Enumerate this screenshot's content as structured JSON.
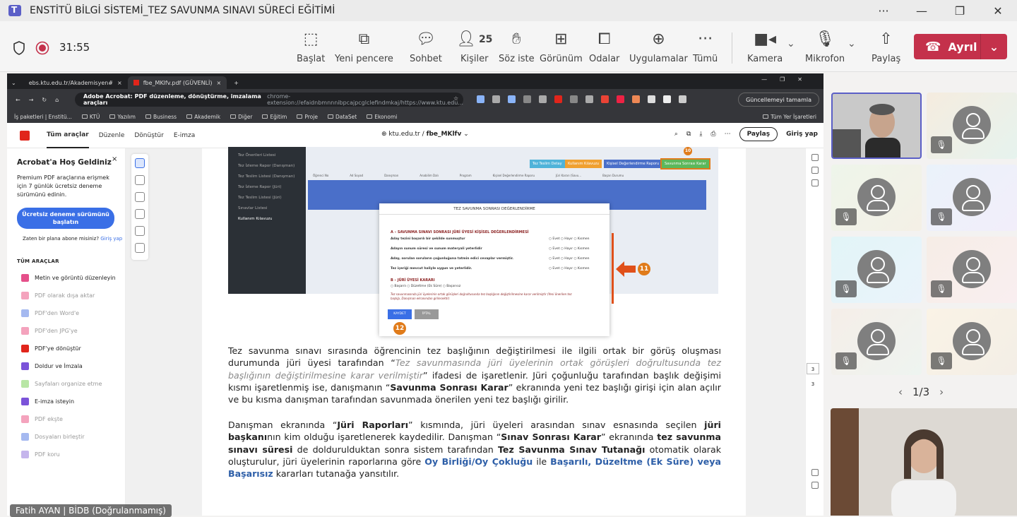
{
  "window": {
    "title": "ENSTİTÜ BİLGİ SİSTEMİ_TEZ SAVUNMA SINAVI SÜRECİ EĞİTİMİ",
    "more": "···",
    "minimize": "—",
    "restore": "❐",
    "close": "✕"
  },
  "meeting": {
    "timer": "31:55",
    "participants_count": "25",
    "buttons": {
      "start": "Başlat",
      "new_window": "Yeni pencere",
      "chat": "Sohbet",
      "people": "Kişiler",
      "raise": "Söz iste",
      "view": "Görünüm",
      "rooms": "Odalar",
      "apps": "Uygulamalar",
      "more": "Tümü",
      "camera": "Kamera",
      "mic": "Mikrofon",
      "share": "Paylaş",
      "leave": "Ayrıl"
    }
  },
  "browser": {
    "tabs": [
      "ebs.ktu.edu.tr/Akademisyen#",
      "fbe_MKlfv.pdf (GÜVENLİ)"
    ],
    "new_tab": "+",
    "address_prefix": "Adobe Acrobat: PDF düzenleme, dönüştürme, imzalama araçları",
    "address_url": "chrome-extension://efaidnbmnnnibpcajpcglclefindmkaj/https://www.ktu.edu...",
    "update_button": "Güncellemeyi tamamla",
    "bookmarks": [
      "İş paketleri | Enstitü...",
      "KTÜ",
      "Yazılım",
      "Business",
      "Akademik",
      "Diğer",
      "Eğitim",
      "Proje",
      "DataSet",
      "Ekonomi"
    ],
    "all_bookmarks": "Tüm Yer İşaretleri"
  },
  "acrobat": {
    "tabs": [
      "Tüm araçlar",
      "Düzenle",
      "Dönüştür",
      "E-imza"
    ],
    "doc_domain": "ktu.edu.tr",
    "doc_sep": "/",
    "doc_name": "fbe_MKlfv",
    "share": "Paylaş",
    "signin": "Giriş yap",
    "sidebar": {
      "heading": "Acrobat'a Hoş Geldiniz",
      "close": "×",
      "desc": "Premium PDF araçlarına erişmek için 7 günlük ücretsiz deneme sürümünü edinin.",
      "trial": "Ücretsiz deneme sürümünü başlatın",
      "sub_q": "Zaten bir plana abone misiniz?",
      "sub_link": "Giriş yap",
      "section": "TÜM ARAÇLAR",
      "tools": [
        "Metin ve görüntü düzenleyin",
        "PDF olarak dışa aktar",
        "PDF'den Word'e",
        "PDF'den JPG'ye",
        "PDF'ye dönüştür",
        "Doldur ve İmzala",
        "Sayfaları organize etme",
        "E-imza isteyin",
        "PDF ekşte",
        "Dosyaları birleştir",
        "PDF koru"
      ]
    },
    "page_current": "3",
    "page_total": "3"
  },
  "doc_image": {
    "nav": [
      "Tez Önerileri Listesi",
      "Tez İzleme Rapor (Danışman)",
      "Tez Teslim Listesi (Danışman)",
      "Tez İzleme Rapor (Jüri)",
      "Tez Teslim Listesi (Jüri)",
      "Sınavlar Listesi",
      "Kullanım Kılavuzu"
    ],
    "btns": [
      "Tez Teslim Detay",
      "Kullanım Kılavuzu",
      "Kişisel Değerlendirme Raporu",
      "Savunma Sonrası Karar"
    ],
    "cols": [
      "Öğrenci No",
      "Ad Soyad",
      "Danışman",
      "Anabilim Dalı",
      "Program",
      "Kişisel Değerlendirme Raporu",
      "Jüri Kararı (Savu...",
      "Başarı Durumu"
    ],
    "dialog_title": "TEZ SAVUNMA SONRASI DEĞERLENDİRME",
    "sec_a": "A – SAVUNMA SINAVI SONRASI JÜRİ ÜYESİ KİŞİSEL DEĞERLENDİRMESİ",
    "rows": [
      "Aday tezini başarılı bir şekilde sunmuştur",
      "Adayın sunum süresi ve sunum materyali yeterlidir",
      "Aday, sorulan soruların çoğunluğuna tatmin edici cevaplar vermiştir.",
      "Tez içeriği mevcut haliyle uygun ve yeterlidir."
    ],
    "opts": [
      "Evet",
      "Hayır",
      "Kısmen"
    ],
    "sec_b": "B – JÜRİ ÜYESİ KARARI",
    "b_opts": [
      "Başarılı",
      "Düzeltme (Ek Süre)",
      "Başarısız"
    ],
    "note": "Tez savunmasında jüri üyelerinin ortak görüşleri doğrultusunda tez başlığının değiştirilmesine karar verilmiştir (Yeni önerilen tez başlığı, Danışman ekranından girilecektir)",
    "save": "KAYDET",
    "cancel": "İPTAL",
    "marker_11": "11",
    "marker_12": "12",
    "marker_top": "10"
  },
  "paragraph1": {
    "t1": "Tez savunma sınavı sırasında öğrencinin tez başlığının değiştirilmesi ile ilgili ortak bir görüş oluşması durumunda jüri üyesi tarafından “",
    "t2": "Tez savunmasında jüri üyelerinin ortak görüşleri doğrultusunda tez başlığının değiştirilmesine karar verilmiştir",
    "t3": "” ifadesi de işaretlenir. Jüri çoğunluğu tarafından başlık değişimi kısmı işaretlenmiş ise, danışmanın “",
    "t4": "Savunma Sonrası Karar",
    "t5": "” ekranında yeni tez başlığı girişi için alan açılır ve bu kısma danışman tarafından savunmada önerilen yeni tez başlığı girilir."
  },
  "paragraph2": {
    "t1": "Danışman ekranında “",
    "t2": "Jüri Raporları",
    "t3": "” kısmında, jüri üyeleri arasından sınav esnasında seçilen ",
    "t4": "jüri başkanı",
    "t5": "nın kim olduğu işaretlenerek kaydedilir. Danışman “",
    "t6": "Sınav Sonrası Karar",
    "t7": "” ekranında ",
    "t8": "tez savunma sınavı süresi",
    "t9": " de doldurulduktan sonra sistem tarafından ",
    "t10": "Tez Savunma Sınav Tutanağı",
    "t11": " otomatik olarak oluşturulur, jüri üyelerinin raporlarına göre ",
    "t12": "Oy Birliği/Oy Çokluğu",
    "t13": " ile ",
    "t14": "Başarılı, Düzeltme (Ek Süre) veya Başarısız",
    "t15": " kararları tutanağa yansıtılır."
  },
  "presenter_name": "Fatih AYAN | BİDB (Doğrulanmamış)",
  "gallery": {
    "pager": "1/3",
    "prev": "‹",
    "next": "›",
    "muted_icon": "🎙"
  }
}
